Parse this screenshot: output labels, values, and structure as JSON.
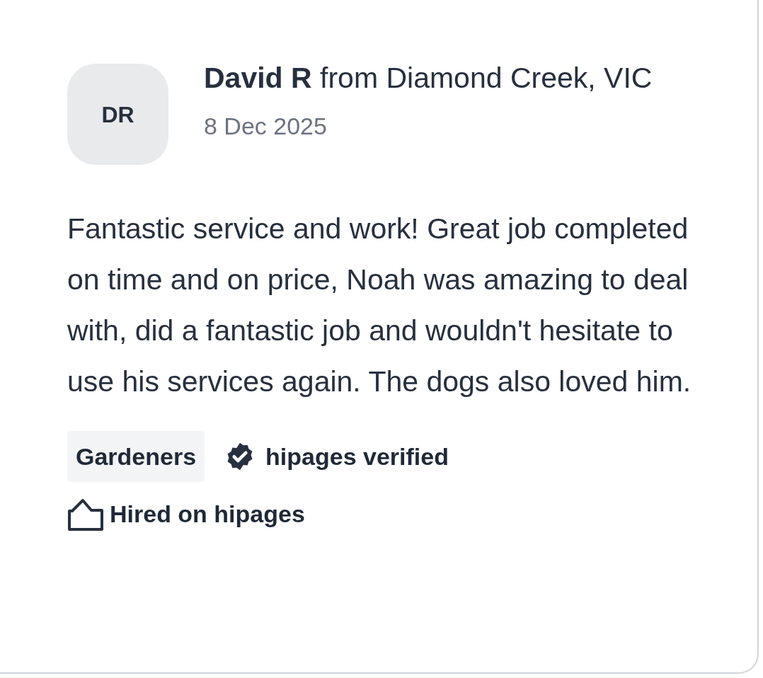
{
  "review": {
    "avatar_initials": "DR",
    "reviewer": "**David R** from Diamond Creek, VIC",
    "date": "8 Dec 2025",
    "text": "Fantastic service and work! Great job completed on time and on price, Noah was amazing to deal with, did a fantastic job and wouldn't hesitate to use his services again. The dogs also loved him.",
    "category": "Gardeners",
    "verified": true,
    "verified_label": "hipages verified",
    "hired": true,
    "hired_label": "Hired on hipages"
  }
}
